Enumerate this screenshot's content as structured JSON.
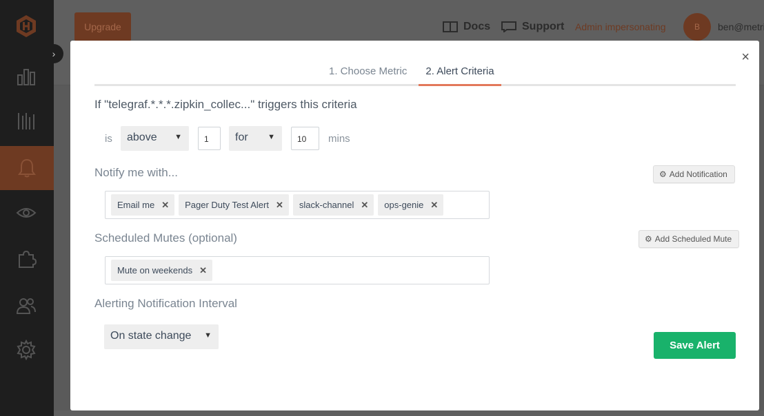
{
  "app": {
    "upgrade_label": "Upgrade",
    "docs_label": "Docs",
    "support_label": "Support",
    "impersonating_label": "Admin impersonating",
    "avatar_initial": "B",
    "user_name": "ben@metri",
    "colors": {
      "sidebar": "#1e1e1e",
      "accent": "#e2785a",
      "active_nav": "#6e3a22"
    }
  },
  "modal": {
    "close_label": "×",
    "tabs": [
      {
        "label": "1. Choose Metric",
        "active": false
      },
      {
        "label": "2. Alert Criteria",
        "active": true
      }
    ],
    "criteria": {
      "title": "If \"telegraf.*.*.*.zipkin_collec...\" triggers this criteria",
      "is_label": "is",
      "comparator": "above",
      "threshold": "1",
      "duration_mode": "for",
      "duration": "10",
      "unit_label": "mins"
    },
    "notify": {
      "title": "Notify me with...",
      "add_label": "Add Notification",
      "tags": [
        "Email me",
        "Pager Duty Test Alert",
        "slack-channel",
        "ops-genie"
      ]
    },
    "mutes": {
      "title": "Scheduled Mutes (optional)",
      "add_label": "Add Scheduled Mute",
      "tags": [
        "Mute on weekends"
      ]
    },
    "interval": {
      "title": "Alerting Notification Interval",
      "value": "On state change"
    },
    "save_label": "Save Alert",
    "colors": {
      "save": "#19b26b",
      "tab_underline": "#e2785a"
    }
  }
}
